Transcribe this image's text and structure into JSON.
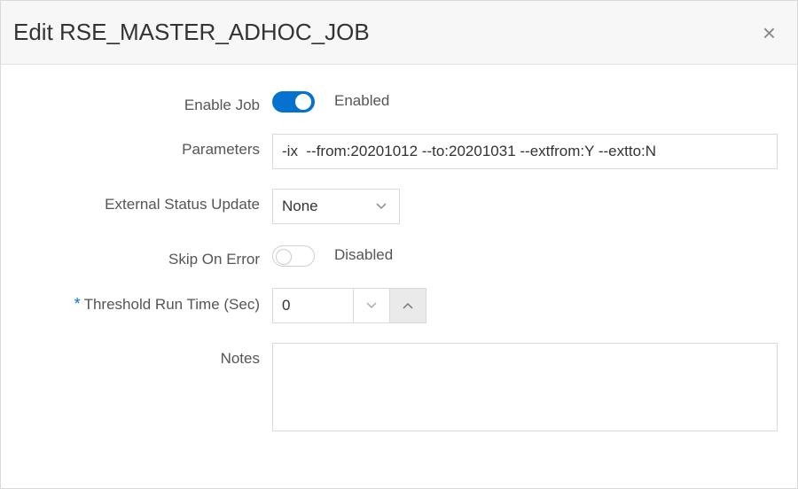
{
  "header": {
    "title": "Edit RSE_MASTER_ADHOC_JOB"
  },
  "fields": {
    "enableJob": {
      "label": "Enable Job",
      "stateLabel": "Enabled"
    },
    "parameters": {
      "label": "Parameters",
      "value": "-ix  --from:20201012 --to:20201031 --extfrom:Y --extto:N"
    },
    "externalStatus": {
      "label": "External Status Update",
      "value": "None"
    },
    "skipOnError": {
      "label": "Skip On Error",
      "stateLabel": "Disabled"
    },
    "threshold": {
      "label": "Threshold Run Time (Sec)",
      "value": "0"
    },
    "notes": {
      "label": "Notes",
      "value": ""
    }
  }
}
